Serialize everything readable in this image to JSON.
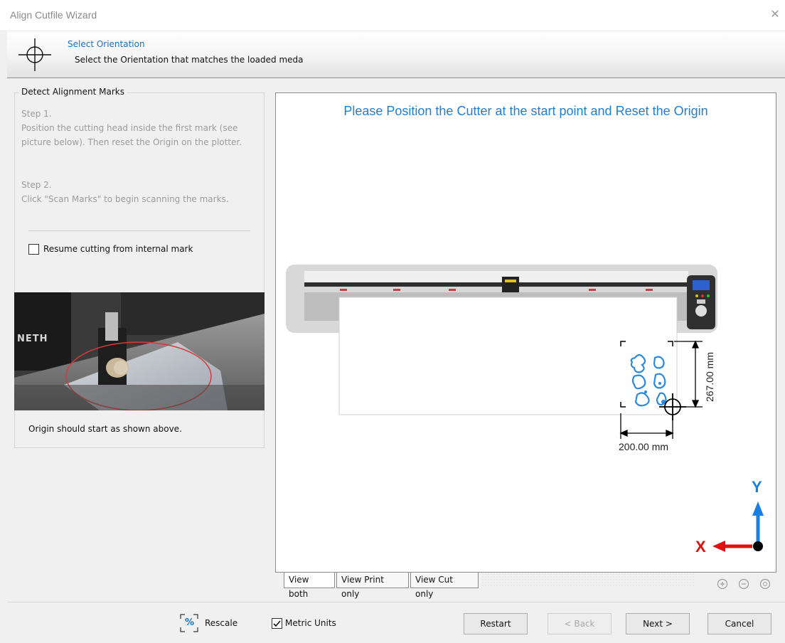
{
  "window": {
    "title": "Align Cutfile Wizard",
    "close_glyph": "✕"
  },
  "header": {
    "title": "Select Orientation",
    "subtitle": "Select the Orientation that matches the loaded meda",
    "icon": "crosshair-icon"
  },
  "left_panel": {
    "group_title": "Detect Alignment Marks",
    "step1_title": "Step 1.",
    "step1_body": "Position the cutting head inside the first mark (see picture below). Then reset the Origin on the plotter.",
    "step2_title": "Step 2.",
    "step2_body": "Click \"Scan Marks\" to begin scanning the marks.",
    "resume_label": "Resume cutting from internal mark",
    "resume_checked": false,
    "photo_text": "NETH",
    "origin_note": "Origin should start as shown above."
  },
  "preview": {
    "headline": "Please Position the Cutter at the start point and Reset the Origin",
    "height_dim": "267.00 mm",
    "width_dim": "200.00 mm",
    "axis_x": "X",
    "axis_y": "Y",
    "tabs": [
      {
        "label": "View both",
        "active": true
      },
      {
        "label": "View Print only",
        "active": false
      },
      {
        "label": "View Cut only",
        "active": false
      }
    ],
    "zoom_icons": [
      "zoom-in-icon",
      "zoom-out-icon",
      "zoom-fit-icon"
    ]
  },
  "footer": {
    "rescale_label": "Rescale",
    "rescale_glyph": "%",
    "metric_label": "Metric Units",
    "metric_checked": true,
    "restart": "Restart",
    "back": "< Back",
    "next": "Next >",
    "cancel": "Cancel"
  },
  "colors": {
    "accent_blue": "#1f7fd4",
    "axis_red": "#e01010",
    "axis_blue": "#1a7fe0",
    "shape_blue": "#2a8ae0"
  }
}
